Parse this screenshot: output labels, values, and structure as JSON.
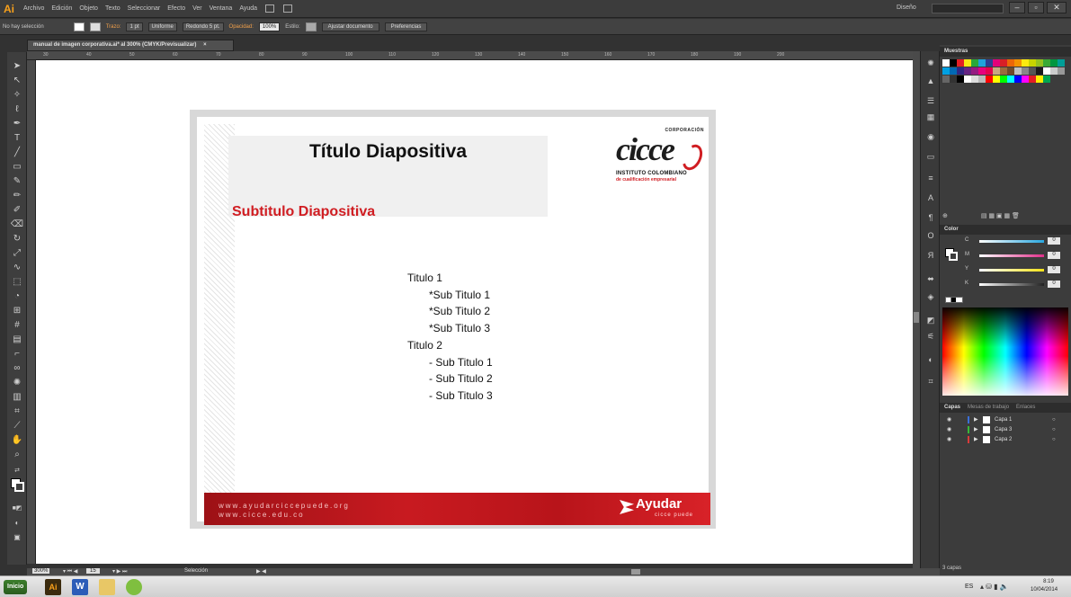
{
  "app": {
    "logo": "Ai",
    "workspace": "Diseño",
    "search_placeholder": ""
  },
  "menu": [
    "Archivo",
    "Edición",
    "Objeto",
    "Texto",
    "Seleccionar",
    "Efecto",
    "Ver",
    "Ventana",
    "Ayuda"
  ],
  "window": {
    "minimize": "–",
    "maximize": "▫",
    "close": "✕"
  },
  "control_bar": {
    "selection": "No hay selección",
    "stroke_label": "Trazo:",
    "stroke_value": "1 pt",
    "stroke_style": "Uniforme",
    "brush": "Redondo 5 pt.",
    "opacity_label": "Opacidad:",
    "opacity_value": "100%",
    "style_label": "Estilo:",
    "adjust_doc": "Ajustar documento",
    "preferences": "Preferencias"
  },
  "document_tab": {
    "title": "manual de imagen corporativa.ai* al 300% (CMYK/Previsualizar)",
    "close": "×"
  },
  "ruler_ticks": [
    "30",
    "40",
    "50",
    "60",
    "70",
    "80",
    "90",
    "100",
    "110",
    "120",
    "130",
    "140",
    "150",
    "160",
    "170",
    "180",
    "190",
    "200"
  ],
  "slide": {
    "title": "Título Diapositiva",
    "subtitle": "Subtitulo Diapositiva",
    "logo_top": "CORPORACIÓN",
    "logo_main": "cicce",
    "logo_line1": "INSTITUTO COLOMBIANO",
    "logo_line2": "de cualificación empresarial",
    "lines": [
      {
        "text": "Titulo 1",
        "indent": false
      },
      {
        "text": "*Sub Titulo 1",
        "indent": true
      },
      {
        "text": "*Sub Titulo 2",
        "indent": true
      },
      {
        "text": "*Sub Titulo 3",
        "indent": true
      },
      {
        "text": "Titulo 2",
        "indent": false
      },
      {
        "text": "- Sub Titulo 1",
        "indent": true
      },
      {
        "text": "- Sub Titulo 2",
        "indent": true
      },
      {
        "text": "- Sub Titulo 3",
        "indent": true
      }
    ],
    "footer_url1": "www.ayudarciccepuede.org",
    "footer_url2": "www.cicce.edu.co",
    "footer_brand": "Ayudar",
    "footer_brand_sub": "cicce puede"
  },
  "panels": {
    "swatches_title": "Muestras",
    "color_title": "Color",
    "cmyk": [
      {
        "label": "C",
        "value": "0",
        "color": "#2aa8e0"
      },
      {
        "label": "M",
        "value": "0",
        "color": "#e0308a"
      },
      {
        "label": "Y",
        "value": "0",
        "color": "#f2e21a"
      },
      {
        "label": "K",
        "value": "0",
        "color": "#222222"
      }
    ],
    "layers_tabs": [
      "Capas",
      "Mesas de trabajo",
      "Enlaces"
    ],
    "layers": [
      {
        "name": "Capa 1",
        "color": "#3a6fd8"
      },
      {
        "name": "Capa 3",
        "color": "#38b838"
      },
      {
        "name": "Capa 2",
        "color": "#d83a3a"
      }
    ],
    "layers_count": "3 capas"
  },
  "status": {
    "zoom": "300%",
    "artboard": "15",
    "tool": "Selección"
  },
  "taskbar": {
    "start": "Inicio",
    "lang": "ES",
    "time": "8:19",
    "date": "10/04/2014"
  }
}
